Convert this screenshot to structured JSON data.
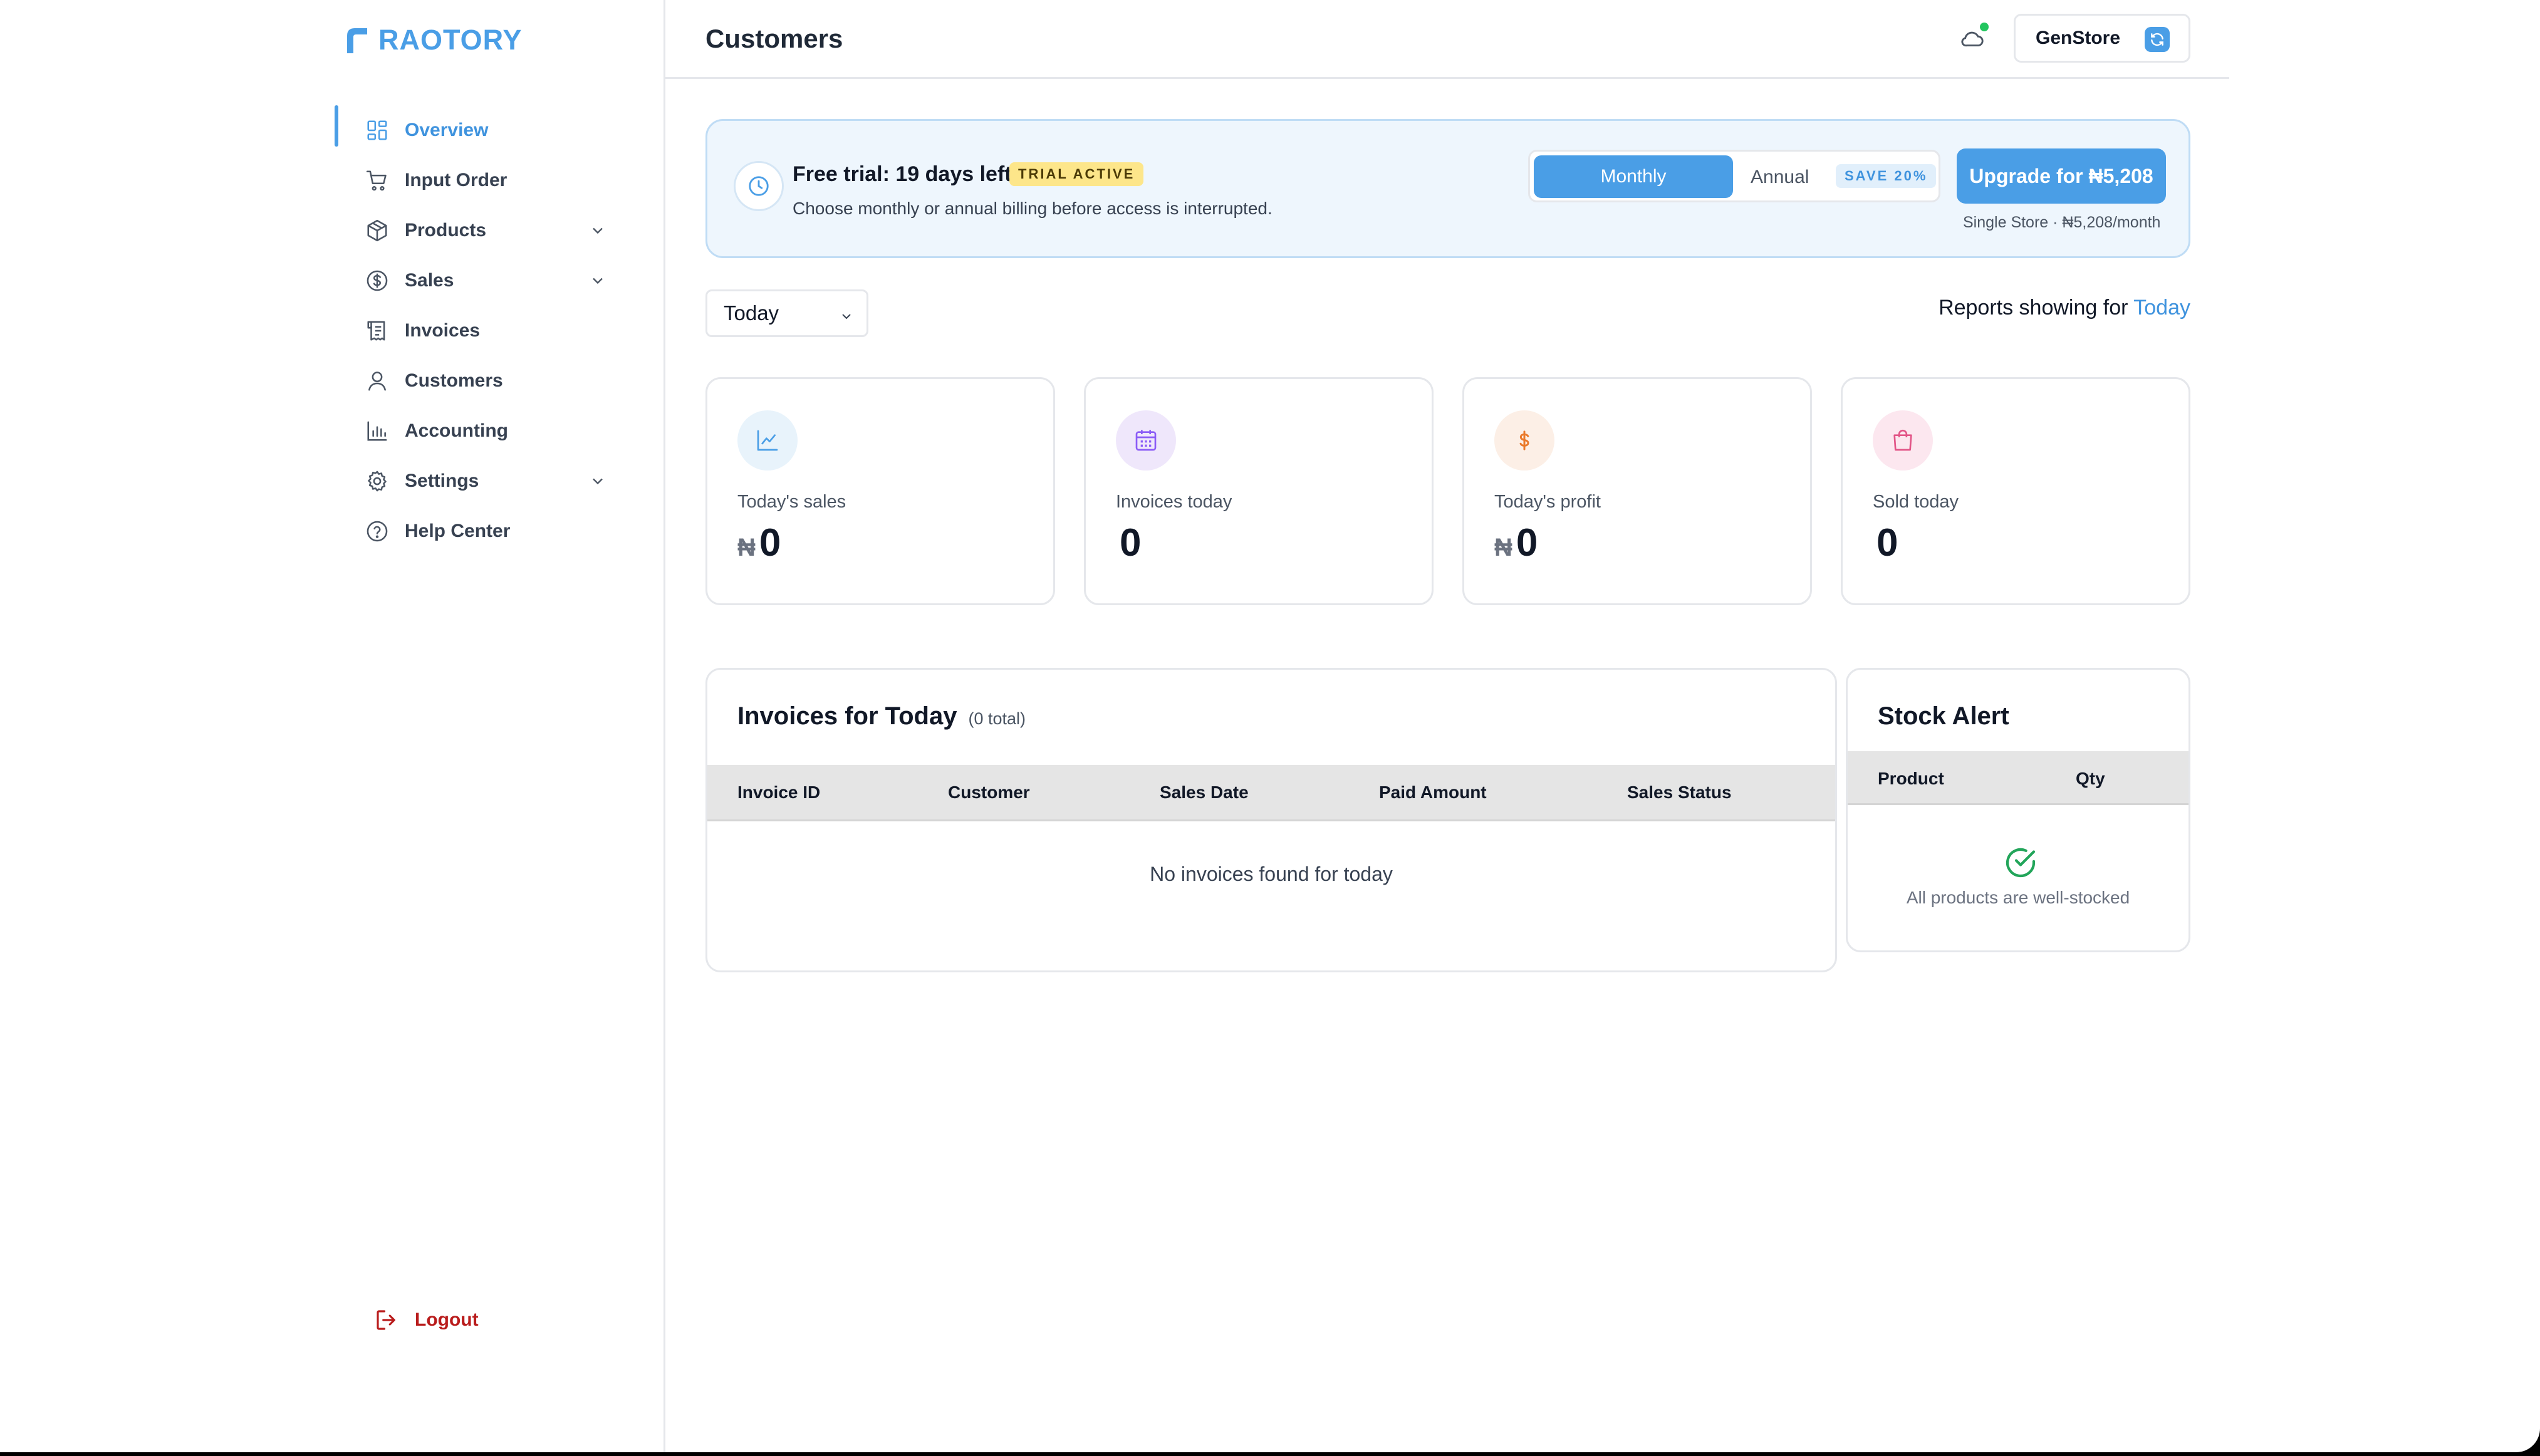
{
  "brand": {
    "name": "RAOTORY",
    "color": "#4a9ee6"
  },
  "sidebar": {
    "items": [
      {
        "label": "Overview",
        "icon": "grid-icon",
        "active": true
      },
      {
        "label": "Input Order",
        "icon": "cart-icon"
      },
      {
        "label": "Products",
        "icon": "box-icon",
        "expandable": true
      },
      {
        "label": "Sales",
        "icon": "dollar-circle-icon",
        "expandable": true
      },
      {
        "label": "Invoices",
        "icon": "receipt-icon"
      },
      {
        "label": "Customers",
        "icon": "user-icon"
      },
      {
        "label": "Accounting",
        "icon": "bar-chart-icon"
      },
      {
        "label": "Settings",
        "icon": "gear-icon",
        "expandable": true
      },
      {
        "label": "Help Center",
        "icon": "help-circle-icon"
      }
    ],
    "logout_label": "Logout"
  },
  "header": {
    "title": "Customers",
    "store_name": "GenStore"
  },
  "trial": {
    "title": "Free trial: 19 days left",
    "badge": "TRIAL ACTIVE",
    "subtitle": "Choose monthly or annual billing before access is interrupted.",
    "monthly_label": "Monthly",
    "annual_label": "Annual",
    "save_badge": "SAVE 20%",
    "upgrade_label": "Upgrade for ₦5,208",
    "plan_note": "Single Store · ₦5,208/month"
  },
  "filter": {
    "selected": "Today",
    "reports_prefix": "Reports showing for ",
    "reports_period": "Today"
  },
  "stats": [
    {
      "label": "Today's sales",
      "currency": "₦",
      "value": "0",
      "icon": "line-chart-icon",
      "bg": "#e8f3fb",
      "fg": "#4a9ee6"
    },
    {
      "label": "Invoices today",
      "currency": "",
      "value": "0",
      "icon": "calendar-icon",
      "bg": "#efe7fb",
      "fg": "#8b5cf6"
    },
    {
      "label": "Today's profit",
      "currency": "₦",
      "value": "0",
      "icon": "dollar-icon",
      "bg": "#fcefe6",
      "fg": "#ea7a2b"
    },
    {
      "label": "Sold today",
      "currency": "",
      "value": "0",
      "icon": "shopping-bag-icon",
      "bg": "#fce7ef",
      "fg": "#e25587"
    }
  ],
  "invoices": {
    "title": "Invoices for Today",
    "count": "(0 total)",
    "columns": [
      "Invoice ID",
      "Customer",
      "Sales Date",
      "Paid Amount",
      "Sales Status"
    ],
    "empty": "No invoices found for today"
  },
  "stock": {
    "title": "Stock Alert",
    "columns": [
      "Product",
      "Qty"
    ],
    "empty": "All products are well-stocked"
  }
}
